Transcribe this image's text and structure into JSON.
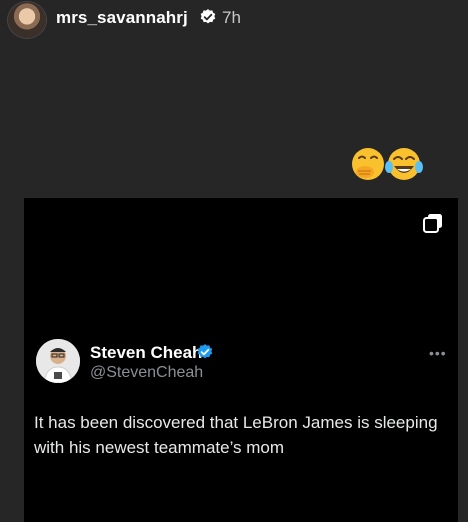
{
  "story": {
    "username": "mrs_savannahrj",
    "time": "7h",
    "reaction_emojis": [
      "face-with-hand-over-mouth",
      "face-with-tears-of-joy"
    ]
  },
  "tweet": {
    "author_name": "Steven Cheah",
    "author_handle": "@StevenCheah",
    "more_label": "•••",
    "text": "It has been discovered that LeBron James is sleeping with his newest teammate’s mom"
  },
  "colors": {
    "story_background": "#262626",
    "tweet_background": "#000000",
    "verified_blue": "#1d9bf0",
    "handle_gray": "#8b8f94"
  }
}
